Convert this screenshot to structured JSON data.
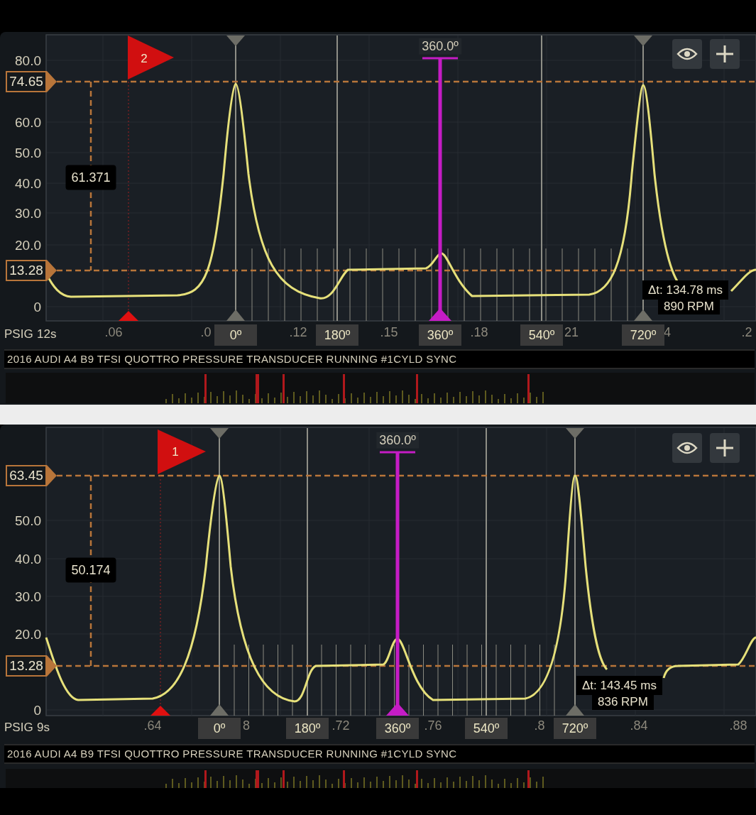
{
  "panels": [
    {
      "flag": "2",
      "cursor_readout": "360.0º",
      "y_labels": [
        "80.0",
        "60.0",
        "50.0",
        "40.0",
        "30.0",
        "20.0",
        "0"
      ],
      "level_markers": [
        "74.65",
        "13.28"
      ],
      "delta_readout": "61.371",
      "unit_label": "PSIG",
      "start_label": "12s",
      "time_labels": [
        ".06",
        ".0",
        ".12",
        ".15",
        ".18",
        "21",
        "4",
        ".2"
      ],
      "angle_labels": [
        "0º",
        "180º",
        "360º",
        "540º",
        "720º"
      ],
      "delta_t": "Δt: 134.78 ms",
      "rpm": "890 RPM",
      "title": "2016 AUDI A4 B9 TFSI QUOTTRO PRESSURE TRANSDUCER RUNNING #1CYLD SYNC"
    },
    {
      "flag": "1",
      "cursor_readout": "360.0º",
      "y_labels": [
        "50.0",
        "40.0",
        "30.0",
        "20.0",
        "0"
      ],
      "level_markers": [
        "63.45",
        "13.28"
      ],
      "delta_readout": "50.174",
      "unit_label": "PSIG",
      "start_label": "9s",
      "time_labels": [
        ".64",
        "8",
        ".72",
        ".76",
        ".8",
        ".84",
        ".88"
      ],
      "angle_labels": [
        "0º",
        "180º",
        "360º",
        "540º",
        "720º"
      ],
      "delta_t": "Δt: 143.45 ms",
      "rpm": "836 RPM",
      "title": "2016 AUDI A4 B9 TFSI QUOTTRO PRESSURE TRANSDUCER RUNNING #1CYLD SYNC"
    }
  ]
}
